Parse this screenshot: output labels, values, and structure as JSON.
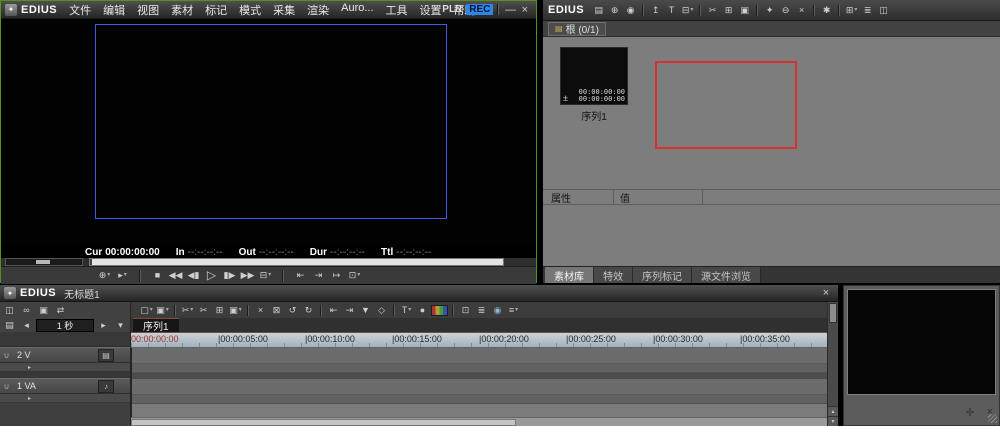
{
  "colors": {
    "rec_highlight": "#2f86e8",
    "selection_red": "#d83030",
    "frame_blue": "#3f5be8",
    "ruler_zero_red": "#9e3030",
    "active_window_green": "#55901f"
  },
  "monitor": {
    "app": "EDIUS",
    "logo_glyph": "✦",
    "menu": [
      {
        "name": "menu-file",
        "label": "文件"
      },
      {
        "name": "menu-edit",
        "label": "编辑"
      },
      {
        "name": "menu-view",
        "label": "视图"
      },
      {
        "name": "menu-clip",
        "label": "素材"
      },
      {
        "name": "menu-marker",
        "label": "标记"
      },
      {
        "name": "menu-mode",
        "label": "模式"
      },
      {
        "name": "menu-capture",
        "label": "采集"
      },
      {
        "name": "menu-render",
        "label": "渲染"
      },
      {
        "name": "menu-auro",
        "label": "Auro..."
      },
      {
        "name": "menu-tools",
        "label": "工具"
      },
      {
        "name": "menu-settings",
        "label": "设置"
      },
      {
        "name": "menu-help",
        "label": "帮助"
      }
    ],
    "plr_label": "PLR",
    "rec_label": "REC",
    "minimize_label": "—",
    "close_label": "×",
    "timecodes": [
      {
        "label": "Cur",
        "value": "00:00:00:00",
        "dim": false
      },
      {
        "label": "In",
        "value": "--:--:--:--",
        "dim": true
      },
      {
        "label": "Out",
        "value": "--:--:--:--",
        "dim": true
      },
      {
        "label": "Dur",
        "value": "--:--:--:--",
        "dim": true
      },
      {
        "label": "Ttl",
        "value": "--:--:--:--",
        "dim": true
      }
    ],
    "transport_left": [
      {
        "name": "zoom-tool-button",
        "glyph": "⊕",
        "dd": true
      },
      {
        "name": "playback-cursor-button",
        "glyph": "▸",
        "dd": true
      }
    ],
    "transport_main": [
      {
        "name": "stop-button",
        "glyph": "■"
      },
      {
        "name": "rewind-button",
        "glyph": "◀◀"
      },
      {
        "name": "previous-frame-button",
        "glyph": "◀▮"
      },
      {
        "name": "play-button",
        "glyph": "▷",
        "cls": "play"
      },
      {
        "name": "next-frame-button",
        "glyph": "▮▶"
      },
      {
        "name": "fast-forward-button",
        "glyph": "▶▶"
      },
      {
        "name": "display-mode-button",
        "glyph": "⊟",
        "dd": true
      }
    ],
    "transport_right": [
      {
        "name": "goto-in-button",
        "glyph": "⇤"
      },
      {
        "name": "goto-out-button",
        "glyph": "⇥"
      },
      {
        "name": "next-edit-point-button",
        "glyph": "↦"
      },
      {
        "name": "player-export-button",
        "glyph": "⊡",
        "dd": true
      }
    ]
  },
  "bin": {
    "app": "EDIUS",
    "toolbar": [
      {
        "name": "folder-icon",
        "glyph": "▤"
      },
      {
        "name": "search-icon",
        "glyph": "⊕"
      },
      {
        "name": "capture-icon",
        "glyph": "◉"
      },
      {
        "name": "add-clip-icon",
        "glyph": "↥",
        "sep": true
      },
      {
        "name": "create-title-icon",
        "glyph": "T"
      },
      {
        "name": "send-to-timeline-icon",
        "glyph": "⊟",
        "dd": true
      },
      {
        "name": "cut-icon",
        "glyph": "✂",
        "sep": true
      },
      {
        "name": "copy-icon",
        "glyph": "⊞"
      },
      {
        "name": "paste-icon",
        "glyph": "▣"
      },
      {
        "name": "pin-icon",
        "glyph": "✦",
        "sep": true
      },
      {
        "name": "remove-icon",
        "glyph": "⊖"
      },
      {
        "name": "delete-icon",
        "glyph": "×"
      },
      {
        "name": "properties-icon",
        "glyph": "✱",
        "sep": true
      },
      {
        "name": "view-thumbnail-icon",
        "glyph": "⊞",
        "dd": true,
        "sep": true
      },
      {
        "name": "view-detail-icon",
        "glyph": "≣"
      },
      {
        "name": "folder-tree-icon",
        "glyph": "◫"
      }
    ],
    "folder_icon": "▤",
    "folder_path": "根 (0/1)",
    "clip": {
      "name": "序列1",
      "corner_icon": "±",
      "timecode_top": "00:00:00:00",
      "timecode_bottom": "00:00:00:00"
    },
    "properties": {
      "col_property": "属性",
      "col_value": "值"
    },
    "tabs": [
      {
        "name": "tab-bin",
        "label": "素材库",
        "active": true
      },
      {
        "name": "tab-effects",
        "label": "特效",
        "active": false
      },
      {
        "name": "tab-sequence-marker",
        "label": "序列标记",
        "active": false
      },
      {
        "name": "tab-source-browser",
        "label": "源文件浏览",
        "active": false
      }
    ]
  },
  "timeline": {
    "app": "EDIUS",
    "logo_glyph": "✦",
    "title": "无标题1",
    "close_label": "×",
    "toolbar": [
      {
        "name": "new-sequence-icon",
        "glyph": "▢",
        "dd": true
      },
      {
        "name": "save-project-icon",
        "glyph": "▣",
        "dd": true
      },
      {
        "name": "cut-clip-icon",
        "glyph": "✂",
        "dd": true,
        "sep": true
      },
      {
        "name": "ripple-cut-icon",
        "glyph": "✂"
      },
      {
        "name": "copy-clip-icon",
        "glyph": "⊞"
      },
      {
        "name": "paste-clip-icon",
        "glyph": "▣",
        "dd": true
      },
      {
        "name": "delete-clip-icon",
        "glyph": "×",
        "sep": true
      },
      {
        "name": "ripple-delete-icon",
        "glyph": "⊠"
      },
      {
        "name": "undo-icon",
        "glyph": "↺"
      },
      {
        "name": "redo-icon",
        "glyph": "↻"
      },
      {
        "name": "set-in-icon",
        "glyph": "⇤",
        "sep": true
      },
      {
        "name": "set-out-icon",
        "glyph": "⇥"
      },
      {
        "name": "add-cut-point-icon",
        "glyph": "▼"
      },
      {
        "name": "match-frame-icon",
        "glyph": "◇"
      },
      {
        "name": "create-title-icon",
        "glyph": "T",
        "dd": true,
        "sep": true
      },
      {
        "name": "voiceover-mic-icon",
        "glyph": "●"
      },
      {
        "name": "colorbar-icon",
        "glyph": "▦",
        "cls": "colorbar"
      },
      {
        "name": "export-icon",
        "glyph": "⊡",
        "sep": true
      },
      {
        "name": "audio-mixer-icon",
        "glyph": "≣"
      },
      {
        "name": "capture-record-icon",
        "glyph": "◉",
        "cls": "record"
      },
      {
        "name": "timeline-menu-icon",
        "glyph": "≡",
        "dd": true
      }
    ],
    "header_tools": [
      {
        "name": "track-layout-icon",
        "glyph": "◫"
      },
      {
        "name": "sync-lock-icon",
        "glyph": "∞"
      },
      {
        "name": "camera-icon",
        "glyph": "▣"
      },
      {
        "name": "patch-icon",
        "glyph": "⇄"
      }
    ],
    "scale": {
      "preset": "▤",
      "dec": "◂",
      "value": "1 秒",
      "inc": "▸",
      "menu": "▾"
    },
    "sequence_tab": "序列1",
    "ruler_ticks": [
      "00:00:00:00",
      "|00:00:05:00",
      "|00:00:10:00",
      "|00:00:15:00",
      "|00:00:20:00",
      "|00:00:25:00",
      "|00:00:30:00",
      "|00:00:35:00"
    ],
    "tracks": [
      {
        "lock": "∪",
        "label": "2 V",
        "icon": "▤",
        "expander": "▸"
      },
      {
        "lock": "∪",
        "label": "1 VA",
        "icon": "♪",
        "expander": "▸"
      }
    ],
    "scrollbar": {
      "up": "▴",
      "down": "▾"
    }
  },
  "aux": {
    "options_glyph": "✛",
    "close_glyph": "×"
  }
}
